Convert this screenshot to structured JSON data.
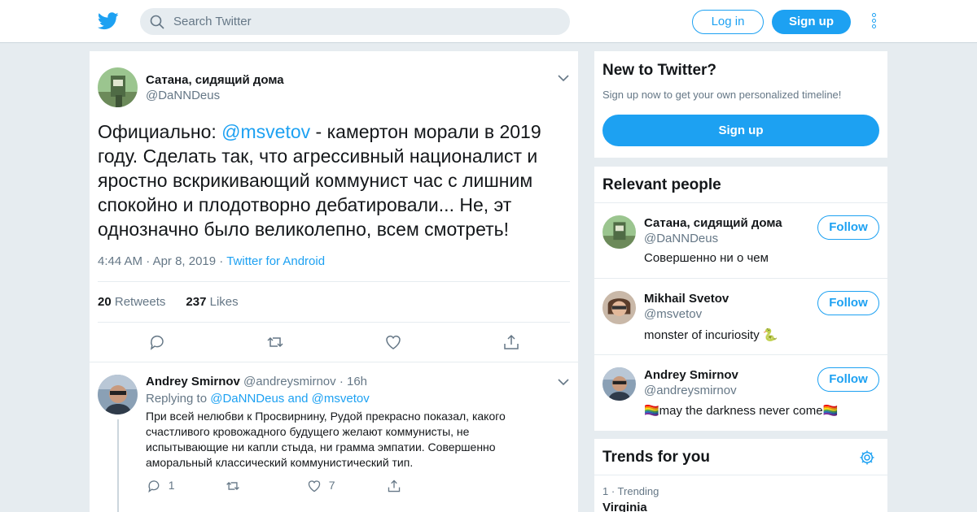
{
  "header": {
    "logo": "twitter-bird-icon",
    "search_placeholder": "Search Twitter",
    "login_label": "Log in",
    "signup_label": "Sign up",
    "brand_color": "#1da1f2"
  },
  "tweet": {
    "author_name": "Сатана, сидящий дома",
    "author_handle": "@DaNNDeus",
    "text_before": "Официально: ",
    "mention": "@msvetov",
    "text_after": " - камертон морали в 2019 году. Сделать так, что агрессивный националист и яростно вскрикивающий коммунист час с лишним спокойно и плодотворно дебатировали... Не, эт однозначно было великолепно, всем смотреть!",
    "time": "4:44 AM",
    "date": "Apr 8, 2019",
    "source": "Twitter for Android",
    "retweets_count": "20",
    "retweets_label": "Retweets",
    "likes_count": "237",
    "likes_label": "Likes"
  },
  "reply": {
    "author_name": "Andrey Smirnov",
    "author_handle": "@andreysmirnov",
    "age": "16h",
    "replying_label": "Replying to",
    "replying_to": "@DaNNDeus and @msvetov",
    "text": "При всей нелюбви к Просвирнину, Рудой прекрасно показал, какого счастливого кровожадного будущего желают коммунисты, не испытывающие ни капли стыда, ни грамма эмпатии. Совершенно аморальный классический коммунистический тип.",
    "reply_count": "1",
    "like_count": "7"
  },
  "new_to_twitter": {
    "title": "New to Twitter?",
    "subtitle": "Sign up now to get your own personalized timeline!",
    "button_label": "Sign up"
  },
  "relevant_people": {
    "title": "Relevant people",
    "follow_label": "Follow",
    "people": [
      {
        "name": "Сатана, сидящий дома",
        "handle": "@DaNNDeus",
        "bio": "Совершенно ни о чем"
      },
      {
        "name": "Mikhail Svetov",
        "handle": "@msvetov",
        "bio": "monster of incuriosity 🐍"
      },
      {
        "name": "Andrey Smirnov",
        "handle": "@andreysmirnov",
        "bio": "🏳️‍🌈may the darkness never come🏳️‍🌈"
      }
    ]
  },
  "trends": {
    "title": "Trends for you",
    "items": [
      {
        "meta": "1 · Trending",
        "topic": "Virginia"
      }
    ]
  }
}
